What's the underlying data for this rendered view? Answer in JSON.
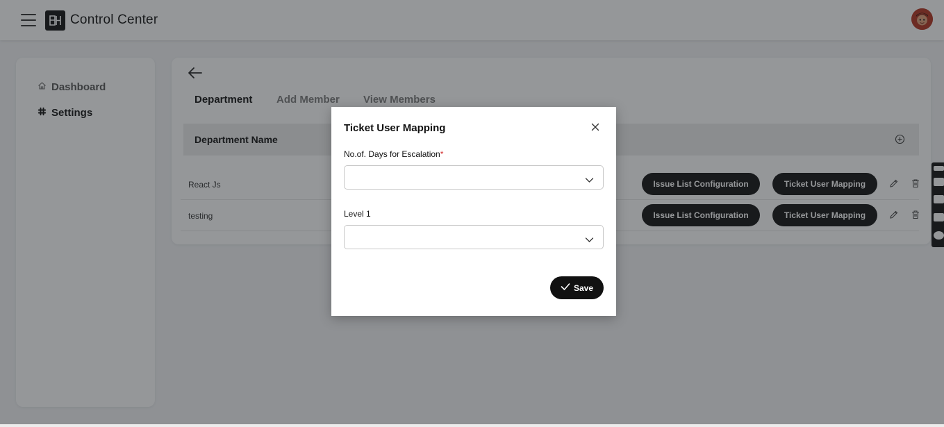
{
  "app": {
    "title": "Control Center"
  },
  "sidebar": {
    "items": [
      {
        "label": "Dashboard",
        "icon": "home-icon"
      },
      {
        "label": "Settings",
        "icon": "slack-icon"
      }
    ]
  },
  "tabs": [
    {
      "label": "Department",
      "active": true
    },
    {
      "label": "Add Member",
      "active": false
    },
    {
      "label": "View Members",
      "active": false
    }
  ],
  "table": {
    "header": "Department Name",
    "rows": [
      {
        "name": "React Js",
        "issue_button": "Issue List Configuration",
        "ticket_button": "Ticket User Mapping"
      },
      {
        "name": "testing",
        "issue_button": "Issue List Configuration",
        "ticket_button": "Ticket User Mapping"
      }
    ]
  },
  "modal": {
    "title": "Ticket User Mapping",
    "field1": {
      "label": "No.of. Days for Escalation",
      "required_mark": "*",
      "value": ""
    },
    "field2": {
      "label": "Level 1",
      "value": ""
    },
    "save_label": "Save"
  },
  "colors": {
    "primary": "#111111",
    "overlay": "#212529",
    "required": "#d32f2f",
    "inactive_tab": "#7a7a7a"
  }
}
